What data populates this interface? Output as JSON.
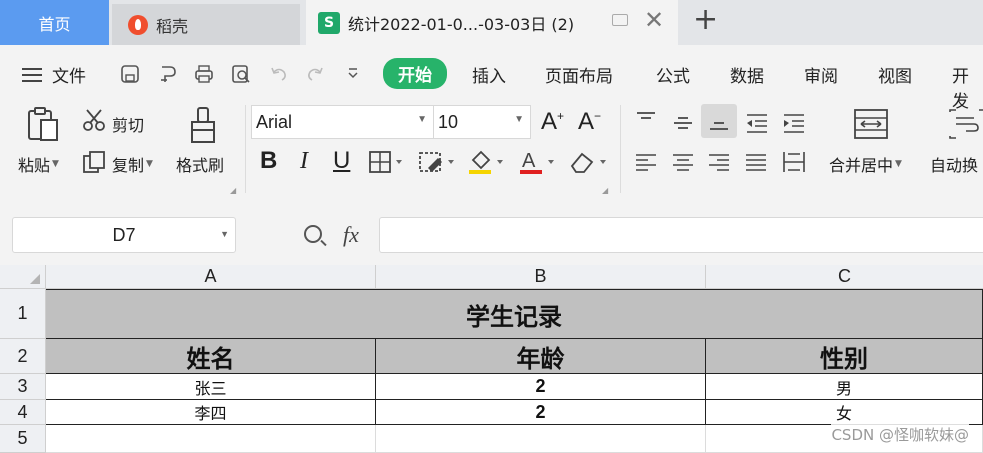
{
  "tabs": {
    "home": "首页",
    "docer": "稻壳",
    "active_doc": "统计2022-01-0...-03-03日 (2)",
    "active_icon_letter": "S"
  },
  "menu": {
    "file": "文件",
    "tabs": [
      "开始",
      "插入",
      "页面布局",
      "公式",
      "数据",
      "审阅",
      "视图",
      "开发"
    ],
    "active_color": "#27b36a"
  },
  "ribbon": {
    "paste": "粘贴",
    "cut": "剪切",
    "copy": "复制",
    "format_painter": "格式刷",
    "font_name": "Arial",
    "font_size": "10",
    "merge_center": "合并居中",
    "auto_wrap": "自动换"
  },
  "formula_bar": {
    "cell_ref": "D7",
    "fx": "fx",
    "value": ""
  },
  "sheet": {
    "columns": [
      "A",
      "B",
      "C"
    ],
    "rows": [
      "1",
      "2",
      "3",
      "4",
      "5"
    ],
    "title": "学生记录",
    "headers": [
      "姓名",
      "年龄",
      "性别"
    ],
    "data": [
      [
        "张三",
        "2",
        "男"
      ],
      [
        "李四",
        "2",
        "女"
      ]
    ],
    "header_fill": "#c0c0c0"
  },
  "watermark": "CSDN @怪咖软妹@"
}
